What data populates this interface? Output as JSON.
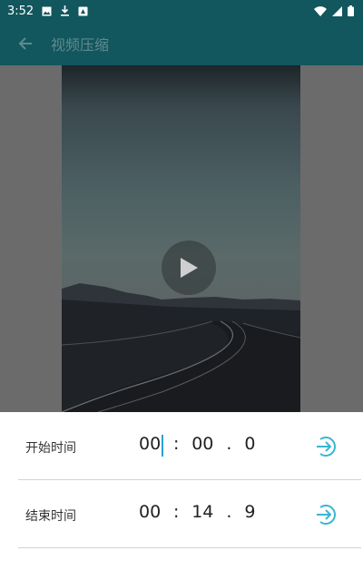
{
  "status_bar": {
    "time": "3:52",
    "left_icons": [
      "image-icon",
      "download-icon",
      "badge-icon"
    ],
    "right_icons": [
      "wifi-icon",
      "signal-icon",
      "battery-icon"
    ]
  },
  "app_bar": {
    "title": "视频压缩",
    "back_icon": "arrow-back-icon"
  },
  "player": {
    "play_icon": "play-icon"
  },
  "trim": {
    "start": {
      "label": "开始时间",
      "minutes": "00",
      "seconds": "00",
      "tenths": "0",
      "separator_colon": ":",
      "separator_dot": "."
    },
    "end": {
      "label": "结束时间",
      "minutes": "00",
      "seconds": "14",
      "tenths": "9",
      "separator_colon": ":",
      "separator_dot": "."
    },
    "go_icon": "arrow-enter-icon"
  },
  "colors": {
    "primary": "#12565e",
    "accent": "#2b9fd6",
    "media_background": "#6b6b6b"
  }
}
